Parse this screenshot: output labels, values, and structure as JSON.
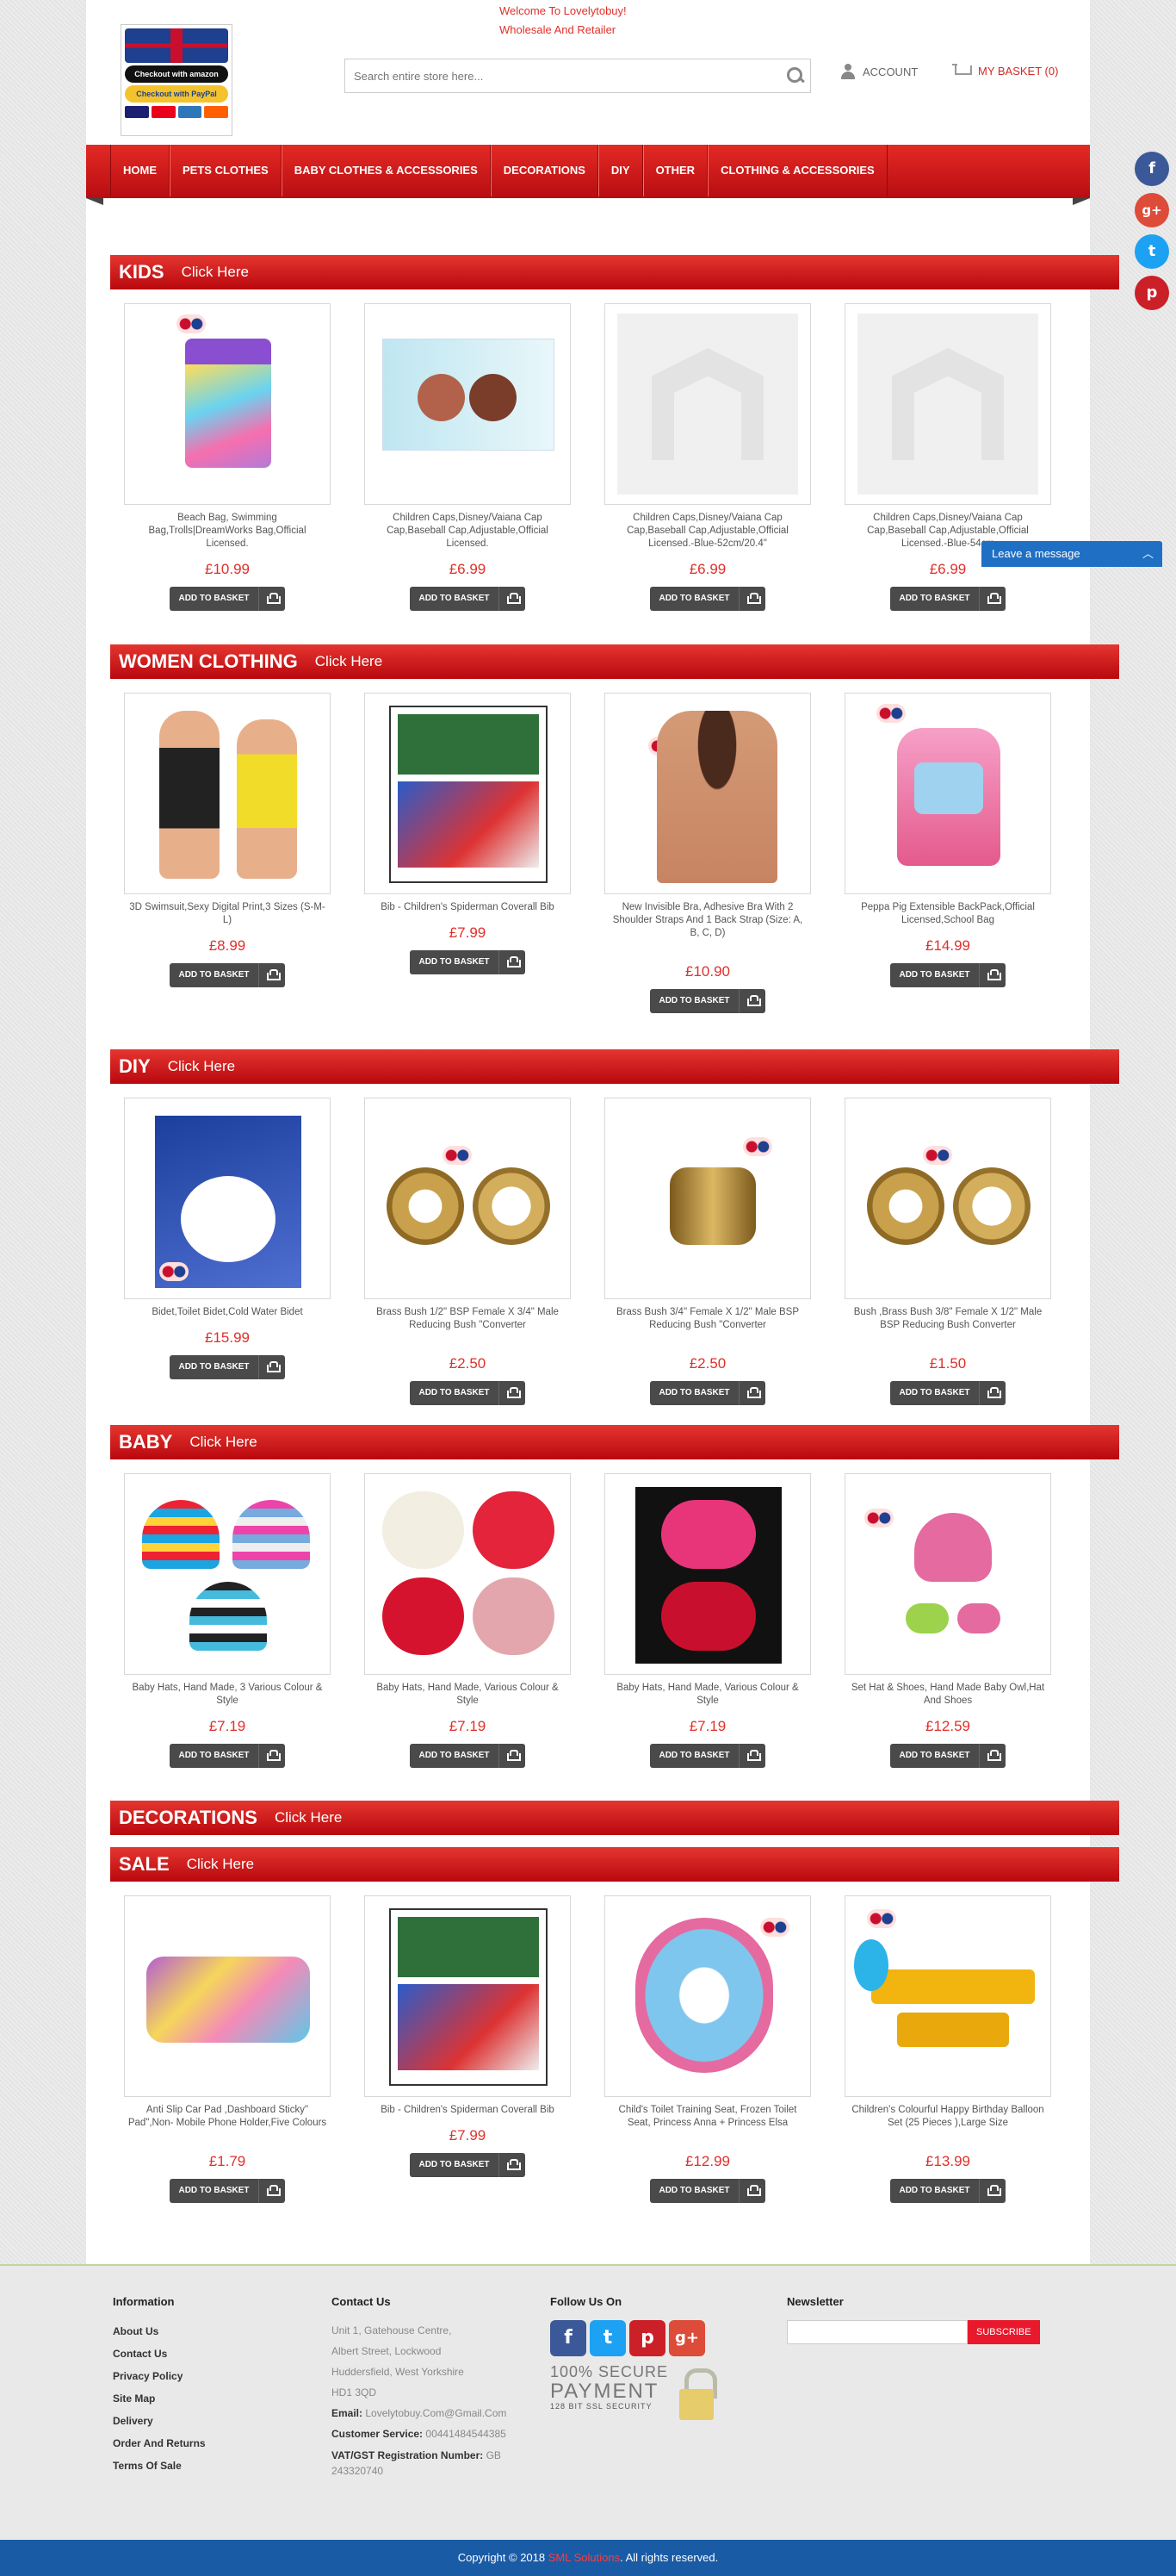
{
  "header": {
    "welcome_line1": "Welcome To Lovelytobuy!",
    "welcome_line2": "Wholesale And Retailer",
    "logo_badge_amazon": "Checkout with amazon",
    "logo_badge_paypal": "Checkout with PayPal",
    "search_placeholder": "Search entire store here...",
    "account_label": "Account",
    "basket_label": "My Basket (0)"
  },
  "nav": {
    "items": [
      "Home",
      "Pets Clothes",
      "Baby Clothes & Accessories",
      "Decorations",
      "DIY",
      "Other",
      "Clothing & Accessories"
    ]
  },
  "social_side": [
    "f",
    "g+",
    "t",
    "p"
  ],
  "colors": {
    "accent_red": "#d0151a",
    "price_red": "#e0302a",
    "facebook": "#3b5998",
    "google": "#dd4b39",
    "twitter": "#1da1f2",
    "pinterest": "#cb2027",
    "footer_blue": "#1a5ba6"
  },
  "chat": {
    "label": "Leave a message"
  },
  "button_label": "Add to basket",
  "click_here": "Click Here",
  "sections": [
    {
      "name": "Kids",
      "products": [
        {
          "title": "Beach Bag, Swimming Bag,Trolls|DreamWorks Bag,Official Licensed.",
          "price": "£10.99",
          "picture": "trolls-bag"
        },
        {
          "title": "Children Caps,Disney/Vaiana Cap Cap,Baseball Cap,Adjustable,Official Licensed.",
          "price": "£6.99",
          "picture": "vaiana-caps"
        },
        {
          "title": "Children Caps,Disney/Vaiana Cap Cap,Baseball Cap,Adjustable,Official Licensed.-Blue-52cm/20.4\"",
          "price": "£6.99",
          "picture": "placeholder"
        },
        {
          "title": "Children Caps,Disney/Vaiana Cap Cap,Baseball Cap,Adjustable,Official Licensed.-Blue-54cm",
          "price": "£6.99",
          "picture": "placeholder"
        }
      ]
    },
    {
      "name": "Women Clothing",
      "products": [
        {
          "title": "3D Swimsuit,Sexy Digital Print,3 Sizes (S-M-L)",
          "price": "£8.99",
          "picture": "swimsuit"
        },
        {
          "title": "Bib - Children's Spiderman Coverall Bib",
          "price": "£7.99",
          "picture": "bib"
        },
        {
          "title": "New Invisible Bra, Adhesive Bra With 2 Shoulder Straps And 1 Back Strap (Size: A, B, C, D)",
          "price": "£10.90",
          "picture": "bra"
        },
        {
          "title": "Peppa Pig Extensible BackPack,Official Licensed,School Bag",
          "price": "£14.99",
          "picture": "backpack"
        }
      ]
    },
    {
      "name": "DIY",
      "products": [
        {
          "title": "Bidet,Toilet Bidet,Cold Water Bidet",
          "price": "£15.99",
          "picture": "bidet"
        },
        {
          "title": "Brass Bush 1/2\" BSP Female X 3/4\" Male Reducing Bush \"Converter",
          "price": "£2.50",
          "picture": "brass"
        },
        {
          "title": "Brass Bush 3/4\" Female X 1/2\" Male BSP Reducing Bush \"Converter",
          "price": "£2.50",
          "picture": "brass-single"
        },
        {
          "title": "Bush ,Brass Bush 3/8\" Female X 1/2\" Male BSP Reducing Bush Converter",
          "price": "£1.50",
          "picture": "brass"
        }
      ]
    },
    {
      "name": "Baby",
      "products": [
        {
          "title": "Baby Hats, Hand Made, 3 Various Colour & Style",
          "price": "£7.19",
          "picture": "hats-stripe"
        },
        {
          "title": "Baby Hats, Hand Made, Various Colour & Style",
          "price": "£7.19",
          "picture": "hats-flower"
        },
        {
          "title": "Baby Hats, Hand Made, Various Colour & Style",
          "price": "£7.19",
          "picture": "hats-dark"
        },
        {
          "title": "Set Hat & Shoes, Hand Made Baby Owl,Hat And Shoes",
          "price": "£12.59",
          "picture": "owl"
        }
      ]
    },
    {
      "name": "Decorations",
      "products": []
    },
    {
      "name": "Sale",
      "products": [
        {
          "title": "Anti Slip Car Pad ,Dashboard Sticky\" Pad\",Non- Mobile Phone Holder,Five Colours",
          "price": "£1.79",
          "picture": "carpads"
        },
        {
          "title": "Bib - Children's Spiderman Coverall Bib",
          "price": "£7.99",
          "picture": "bib"
        },
        {
          "title": "Child's Toilet Training Seat, Frozen Toilet Seat, Princess Anna + Princess Elsa",
          "price": "£12.99",
          "picture": "frozen"
        },
        {
          "title": "Children's Colourful Happy Birthday Balloon Set (25 Pieces ),Large Size",
          "price": "£13.99",
          "picture": "birthday"
        }
      ]
    }
  ],
  "footer": {
    "information_title": "Information",
    "information_links": [
      "About Us",
      "Contact Us",
      "Privacy Policy",
      "Site Map",
      "Delivery",
      "Order And Returns",
      "Terms Of Sale"
    ],
    "contact_title": "Contact Us",
    "address_lines": [
      "Unit 1, Gatehouse Centre,",
      "Albert Street, Lockwood",
      "Huddersfield, West Yorkshire",
      "HD1 3QD"
    ],
    "email_label": "Email:",
    "email_value": "Lovelytobuy.Com@Gmail.Com",
    "service_label": "Customer Service:",
    "service_value": "00441484544385",
    "vat_label": "VAT/GST Registration Number:",
    "vat_value": "GB 243320740",
    "follow_title": "Follow Us On",
    "follow_icons": [
      "f",
      "t",
      "p",
      "g+"
    ],
    "secure_line1": "100% SECURE",
    "secure_line2": "PAYMENT",
    "secure_line3": "128 BIT SSL SECURITY",
    "newsletter_title": "Newsletter",
    "subscribe_label": "Subscribe"
  },
  "copyright": {
    "prefix": "Copyright © 2018",
    "brand": "SML Solutions",
    "suffix": ". All rights reserved."
  }
}
